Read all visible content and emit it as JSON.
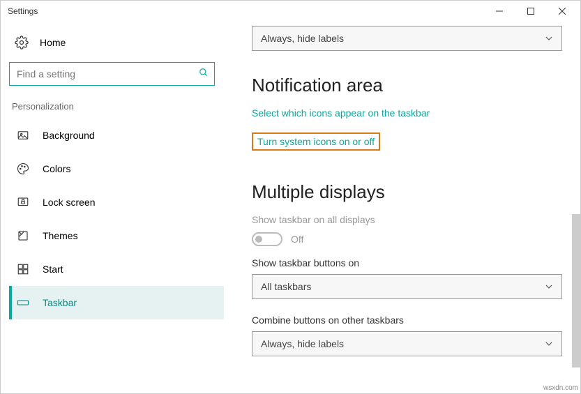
{
  "window": {
    "title": "Settings"
  },
  "sidebar": {
    "home": "Home",
    "search_placeholder": "Find a setting",
    "section": "Personalization",
    "items": [
      {
        "label": "Background",
        "icon": "background-icon",
        "active": false
      },
      {
        "label": "Colors",
        "icon": "colors-icon",
        "active": false
      },
      {
        "label": "Lock screen",
        "icon": "lock-screen-icon",
        "active": false
      },
      {
        "label": "Themes",
        "icon": "themes-icon",
        "active": false
      },
      {
        "label": "Start",
        "icon": "start-icon",
        "active": false
      },
      {
        "label": "Taskbar",
        "icon": "taskbar-icon",
        "active": true
      }
    ]
  },
  "main": {
    "dropdown1_value": "Always, hide labels",
    "notification_heading": "Notification area",
    "link1": "Select which icons appear on the taskbar",
    "link2": "Turn system icons on or off",
    "multiple_heading": "Multiple displays",
    "show_all_label": "Show taskbar on all displays",
    "toggle_state": "Off",
    "show_buttons_label": "Show taskbar buttons on",
    "dropdown2_value": "All taskbars",
    "combine_label": "Combine buttons on other taskbars",
    "dropdown3_value": "Always, hide labels"
  },
  "watermark": "wsxdn.com"
}
